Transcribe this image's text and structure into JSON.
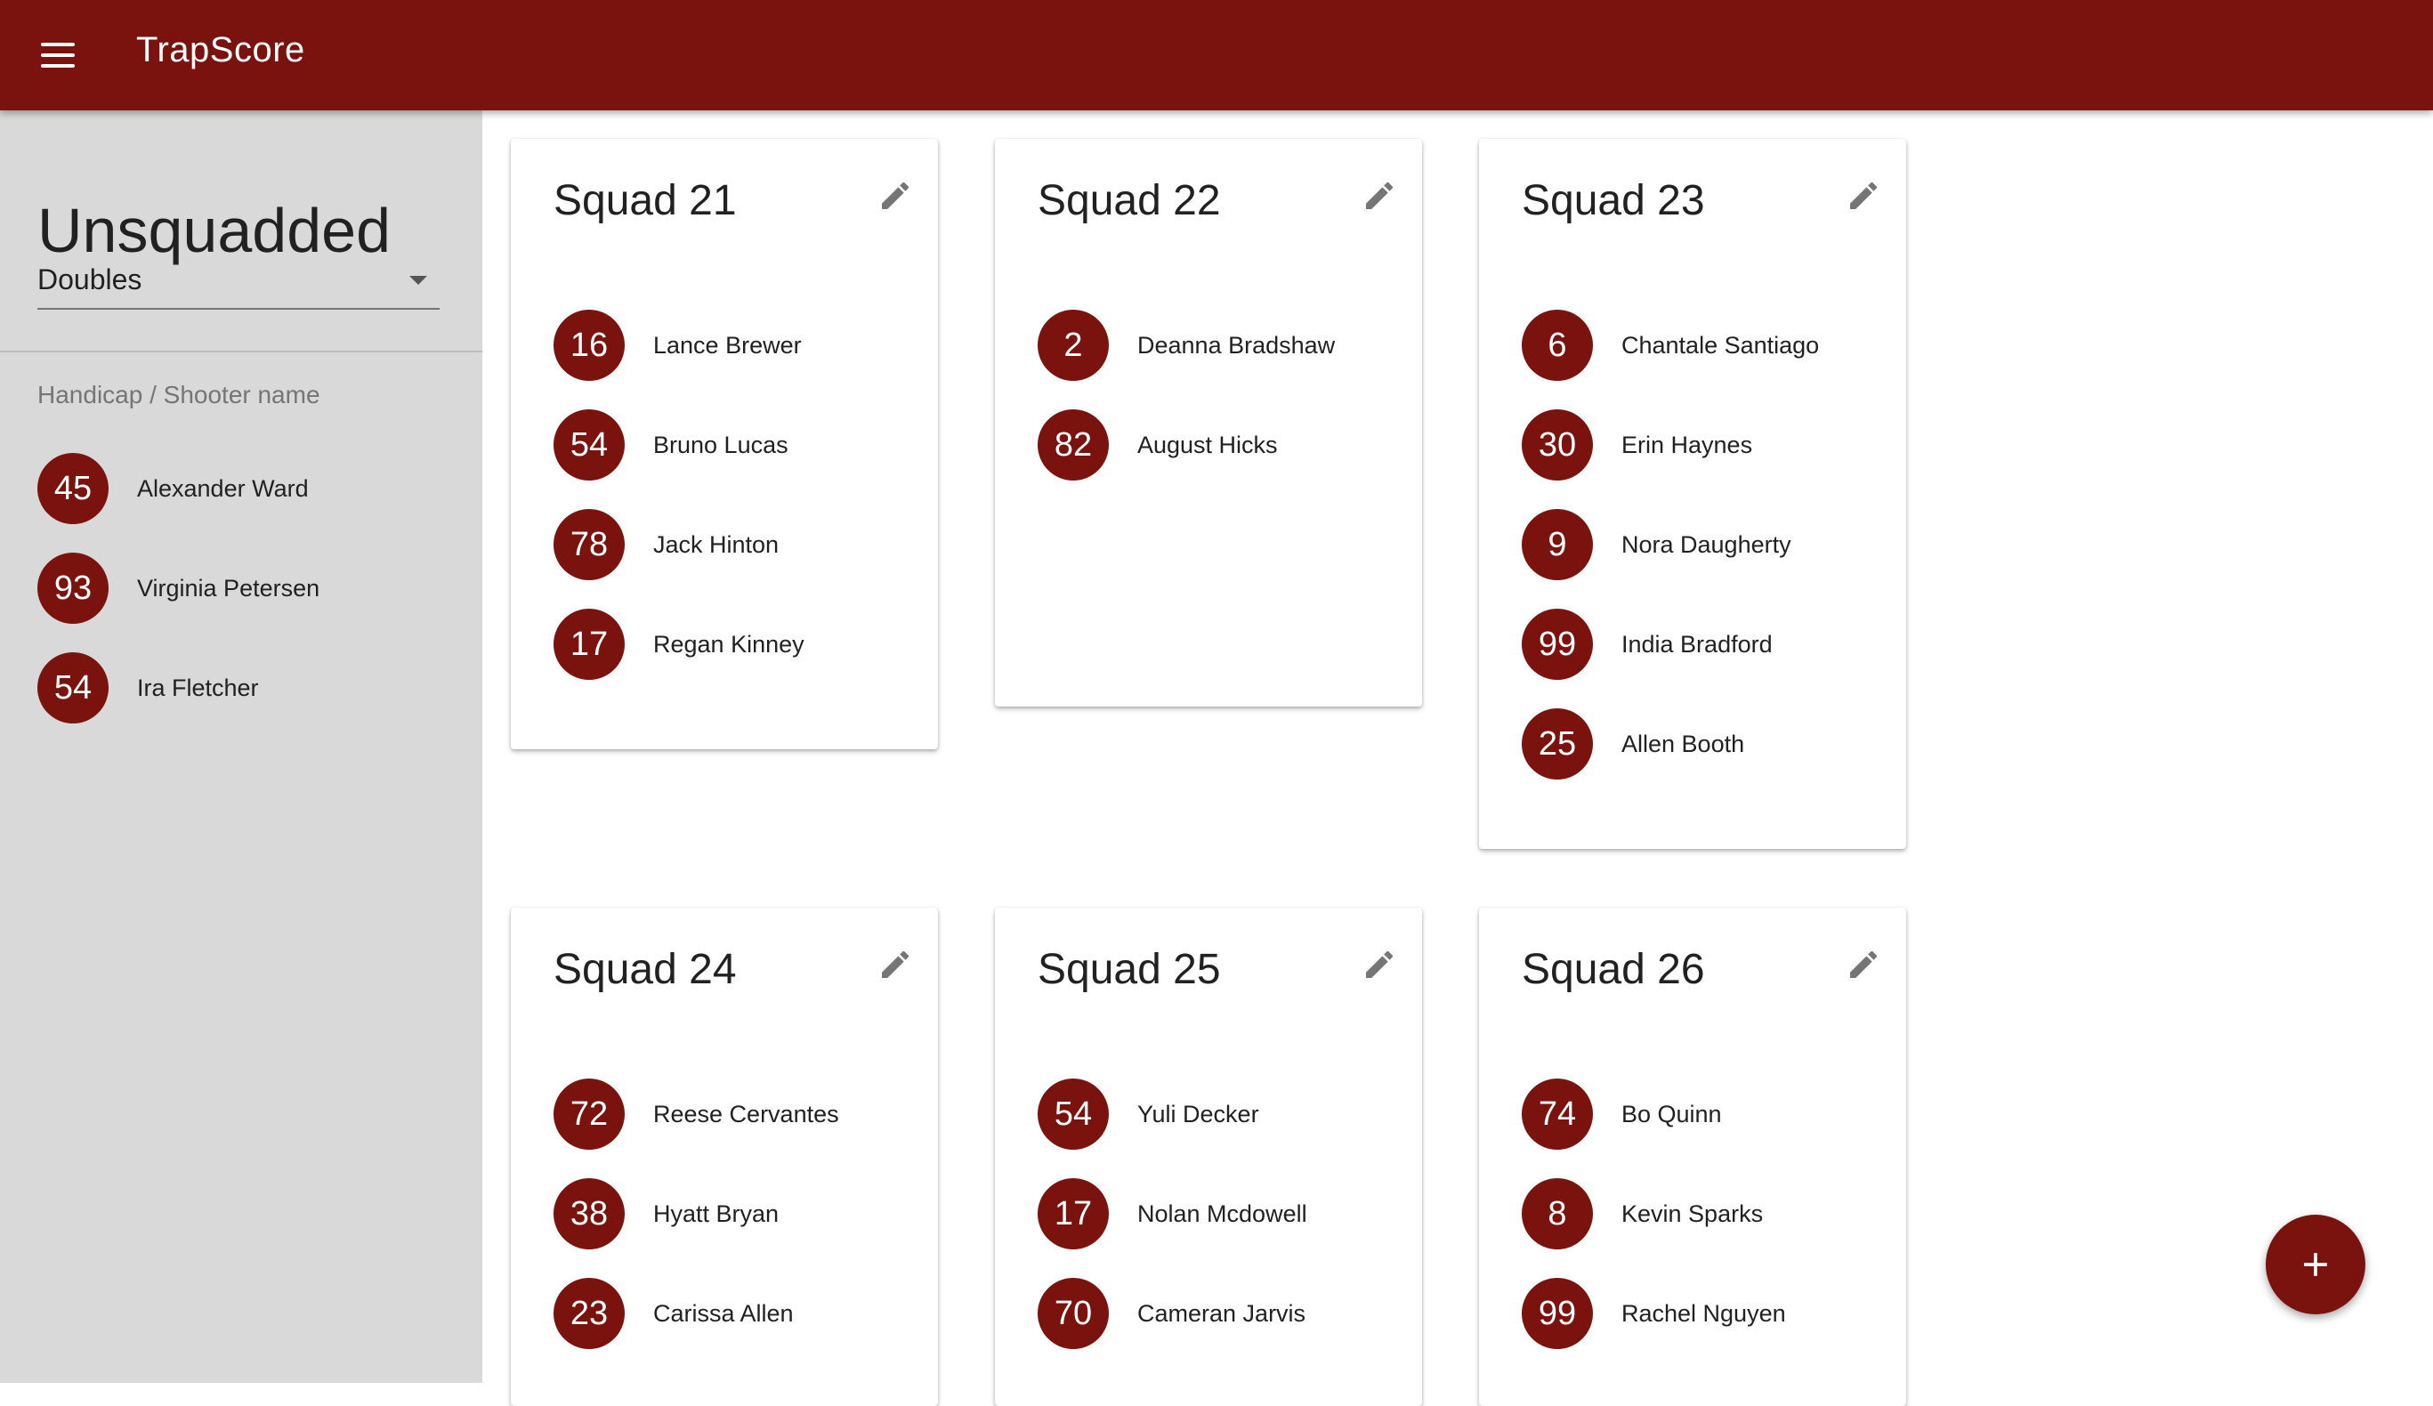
{
  "app": {
    "title": "TrapScore"
  },
  "sidebar": {
    "title": "Unsquadded",
    "select_value": "Doubles",
    "list_header": "Handicap / Shooter name",
    "shooters": [
      {
        "handicap": "45",
        "name": "Alexander Ward"
      },
      {
        "handicap": "93",
        "name": "Virginia Petersen"
      },
      {
        "handicap": "54",
        "name": "Ira Fletcher"
      }
    ]
  },
  "squads": [
    {
      "title": "Squad 21",
      "shooters": [
        {
          "handicap": "16",
          "name": "Lance Brewer"
        },
        {
          "handicap": "54",
          "name": "Bruno Lucas"
        },
        {
          "handicap": "78",
          "name": "Jack Hinton"
        },
        {
          "handicap": "17",
          "name": "Regan Kinney"
        }
      ]
    },
    {
      "title": "Squad 22",
      "shooters": [
        {
          "handicap": "2",
          "name": "Deanna Bradshaw"
        },
        {
          "handicap": "82",
          "name": "August Hicks"
        }
      ]
    },
    {
      "title": "Squad 23",
      "shooters": [
        {
          "handicap": "6",
          "name": "Chantale Santiago"
        },
        {
          "handicap": "30",
          "name": "Erin Haynes"
        },
        {
          "handicap": "9",
          "name": "Nora Daugherty"
        },
        {
          "handicap": "99",
          "name": "India Bradford"
        },
        {
          "handicap": "25",
          "name": "Allen Booth"
        }
      ]
    },
    {
      "title": "Squad 24",
      "shooters": [
        {
          "handicap": "72",
          "name": "Reese Cervantes"
        },
        {
          "handicap": "38",
          "name": "Hyatt Bryan"
        },
        {
          "handicap": "23",
          "name": "Carissa Allen"
        }
      ]
    },
    {
      "title": "Squad 25",
      "shooters": [
        {
          "handicap": "54",
          "name": "Yuli Decker"
        },
        {
          "handicap": "17",
          "name": "Nolan Mcdowell"
        },
        {
          "handicap": "70",
          "name": "Cameran Jarvis"
        }
      ]
    },
    {
      "title": "Squad 26",
      "shooters": [
        {
          "handicap": "74",
          "name": "Bo Quinn"
        },
        {
          "handicap": "8",
          "name": "Kevin Sparks"
        },
        {
          "handicap": "99",
          "name": "Rachel Nguyen"
        }
      ]
    }
  ],
  "icons": {
    "menu": "menu-icon",
    "edit": "pencil-icon",
    "add": "plus-icon"
  },
  "colors": {
    "primary": "#7a130e",
    "sidebar_bg": "#d9d9d9"
  }
}
